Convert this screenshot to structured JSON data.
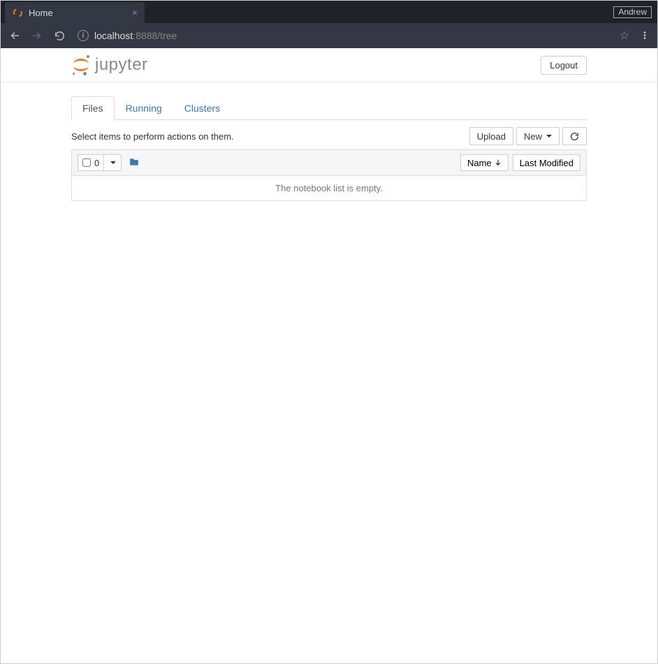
{
  "browser": {
    "tab_title": "Home",
    "user_badge": "Andrew",
    "url_host": "localhost",
    "url_port_path": ":8888/tree"
  },
  "header": {
    "logo_text": "jupyter",
    "logout_label": "Logout"
  },
  "tabs": [
    {
      "label": "Files",
      "active": true
    },
    {
      "label": "Running",
      "active": false
    },
    {
      "label": "Clusters",
      "active": false
    }
  ],
  "toolbar": {
    "hint": "Select items to perform actions on them.",
    "upload_label": "Upload",
    "new_label": "New"
  },
  "list_header": {
    "selected_count": "0",
    "sort_name_label": "Name",
    "sort_modified_label": "Last Modified"
  },
  "list": {
    "empty_message": "The notebook list is empty."
  }
}
